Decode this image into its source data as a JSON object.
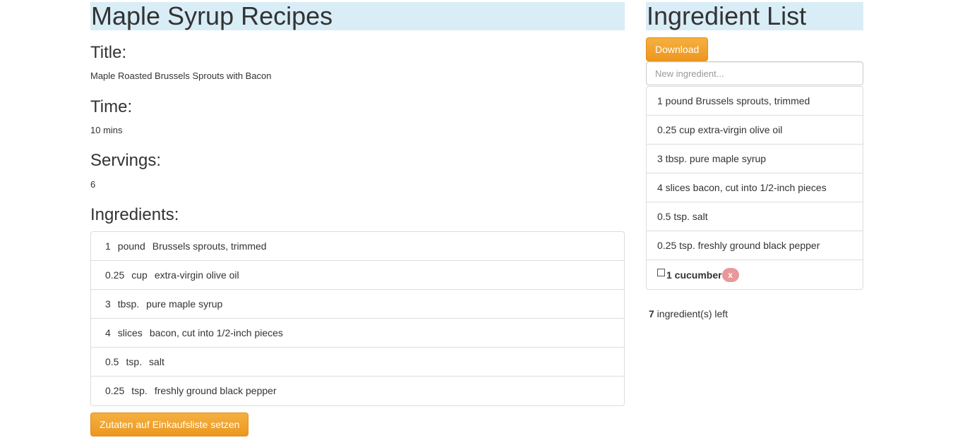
{
  "recipe": {
    "heading": "Maple Syrup Recipes",
    "title_label": "Title:",
    "title_value": "Maple Roasted Brussels Sprouts with Bacon",
    "time_label": "Time:",
    "time_value": "10 mins",
    "servings_label": "Servings:",
    "servings_value": "6",
    "ingredients_label": "Ingredients:",
    "ingredients": [
      {
        "qty": "1",
        "unit": "pound",
        "name": "Brussels sprouts, trimmed"
      },
      {
        "qty": "0.25",
        "unit": "cup",
        "name": "extra-virgin olive oil"
      },
      {
        "qty": "3",
        "unit": "tbsp.",
        "name": "pure maple syrup"
      },
      {
        "qty": "4",
        "unit": "slices",
        "name": "bacon, cut into 1/2-inch pieces"
      },
      {
        "qty": "0.5",
        "unit": "tsp.",
        "name": "salt"
      },
      {
        "qty": "0.25",
        "unit": "tsp.",
        "name": "freshly ground black pepper"
      }
    ],
    "add_to_list_button": "Zutaten auf Einkaufsliste setzen"
  },
  "shopping": {
    "heading": "Ingredient List",
    "download_button": "Download",
    "new_placeholder": "New ingredient...",
    "items": [
      "1 pound Brussels sprouts, trimmed",
      "0.25 cup extra-virgin olive oil",
      "3 tbsp. pure maple syrup",
      "4 slices bacon, cut into 1/2-inch pieces",
      "0.5 tsp. salt",
      "0.25 tsp. freshly ground black pepper"
    ],
    "custom_item": {
      "label": "1 cucumber",
      "checked": false,
      "remove_label": "x"
    },
    "count": "7",
    "count_suffix": " ingredient(s) left"
  },
  "colors": {
    "heading_bg": "#d9edf7",
    "button_orange": "#f0ad4e",
    "badge_pink": "#e8989a"
  }
}
